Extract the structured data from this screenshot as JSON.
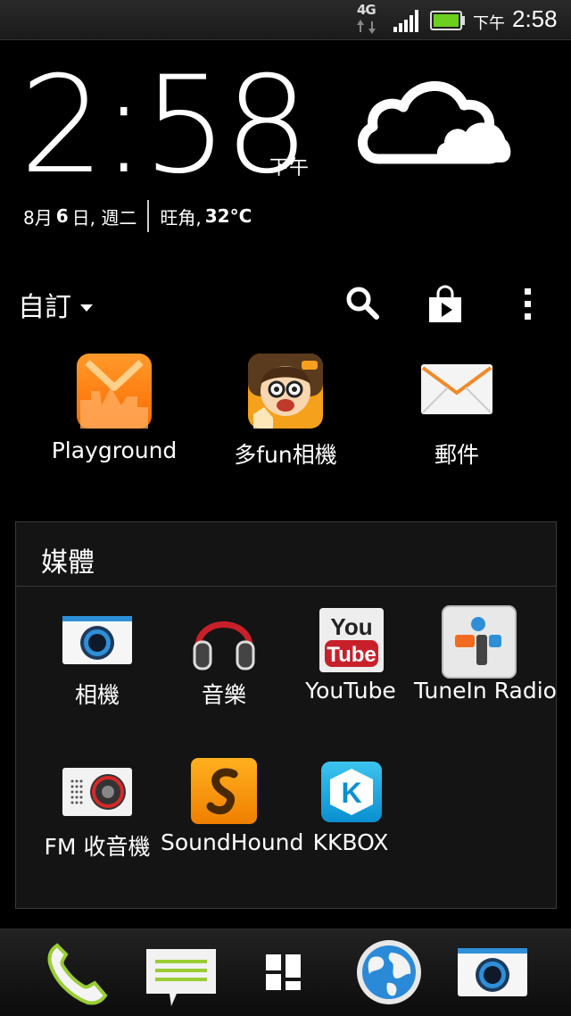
{
  "status_bar": {
    "network": "4G",
    "ampm": "下午",
    "time": "2:58",
    "icons": [
      "network-4g-icon",
      "signal-icon",
      "battery-icon"
    ]
  },
  "clock_widget": {
    "time": "2:58",
    "ampm": "下午",
    "date_prefix": "8月",
    "day": "6",
    "date_suffix": "日, 週二",
    "location": "旺角,",
    "temperature": "32°C",
    "weather_icon": "cloudy-icon"
  },
  "toolbar": {
    "label": "自訂",
    "icons": [
      "search-icon",
      "play-store-icon",
      "more-vert-icon"
    ]
  },
  "apps": [
    {
      "label": "Playground",
      "icon": "playground-icon"
    },
    {
      "label": "多fun相機",
      "icon": "fun-camera-icon"
    },
    {
      "label": "郵件",
      "icon": "mail-icon"
    }
  ],
  "folder": {
    "title": "媒體",
    "apps": [
      {
        "label": "相機",
        "icon": "camera-icon"
      },
      {
        "label": "音樂",
        "icon": "headphones-icon"
      },
      {
        "label": "YouTube",
        "icon": "youtube-icon"
      },
      {
        "label": "TuneIn Radio",
        "icon": "tunein-icon"
      },
      {
        "label": "FM 收音機",
        "icon": "fm-radio-icon"
      },
      {
        "label": "SoundHound",
        "icon": "soundhound-icon"
      },
      {
        "label": "KKBOX",
        "icon": "kkbox-icon"
      }
    ]
  },
  "dock": {
    "icons": [
      "phone-icon",
      "messages-icon",
      "all-apps-icon",
      "browser-icon",
      "camera-icon"
    ]
  },
  "icon_texts": {
    "youtube_you": "You",
    "youtube_tube": "Tube",
    "kkbox_k": "K"
  }
}
